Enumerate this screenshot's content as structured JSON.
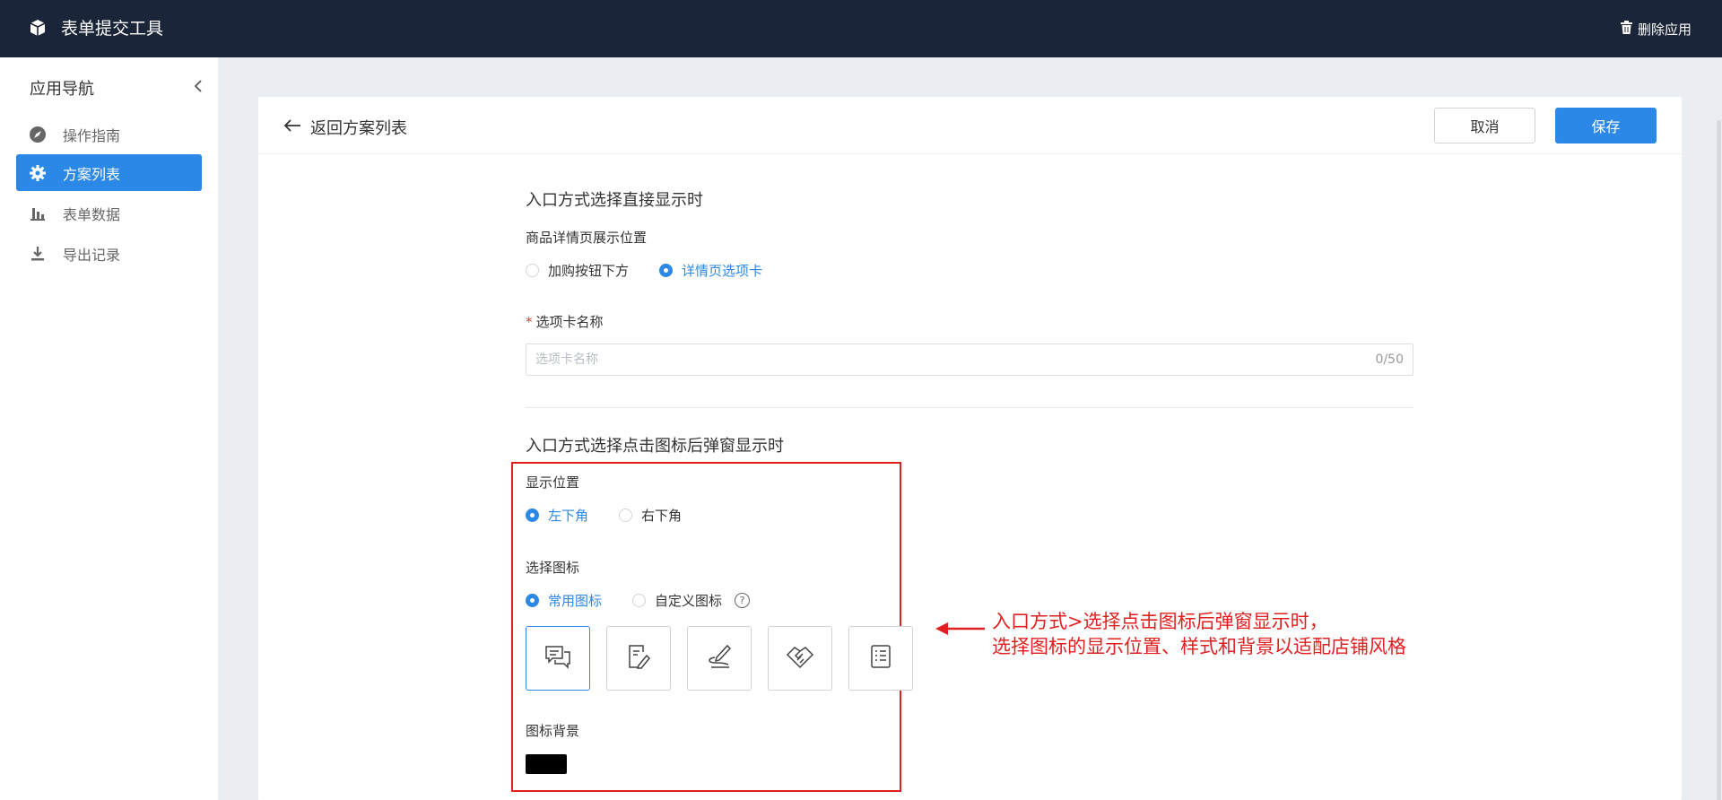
{
  "topbar": {
    "app_title": "表单提交工具",
    "delete_label": "删除应用"
  },
  "sidebar": {
    "title": "应用导航",
    "items": [
      {
        "label": "操作指南",
        "icon": "compass-icon",
        "active": false
      },
      {
        "label": "方案列表",
        "icon": "gear-icon",
        "active": true
      },
      {
        "label": "表单数据",
        "icon": "bar-chart-icon",
        "active": false
      },
      {
        "label": "导出记录",
        "icon": "download-icon",
        "active": false
      }
    ]
  },
  "header": {
    "back_label": "返回方案列表",
    "cancel_label": "取消",
    "save_label": "保存"
  },
  "direct": {
    "section_title": "入口方式选择直接显示时",
    "position_label": "商品详情页展示位置",
    "options": [
      "加购按钮下方",
      "详情页选项卡"
    ],
    "selected": "详情页选项卡",
    "tab_name_label": "选项卡名称",
    "tab_name_placeholder": "选项卡名称",
    "tab_name_value": "",
    "tab_name_counter": "0/50"
  },
  "popup": {
    "section_title": "入口方式选择点击图标后弹窗显示时",
    "display_position_label": "显示位置",
    "position_options": [
      "左下角",
      "右下角"
    ],
    "position_selected": "左下角",
    "icon_label": "选择图标",
    "icon_options": [
      "常用图标",
      "自定义图标"
    ],
    "icon_selected": "常用图标",
    "help_glyph": "?",
    "icons": [
      "chat-icon",
      "edit-doc-icon",
      "sign-icon",
      "handshake-icon",
      "list-doc-icon"
    ],
    "icon_background_label": "图标背景",
    "icon_background_color": "#000000"
  },
  "annotation": {
    "line1": "入口方式>选择点击图标后弹窗显示时，",
    "line2": "选择图标的显示位置、样式和背景以适配店铺风格"
  },
  "colors": {
    "topbar": "#1b2539",
    "accent": "#2b88e6",
    "annotation": "#e02020"
  }
}
